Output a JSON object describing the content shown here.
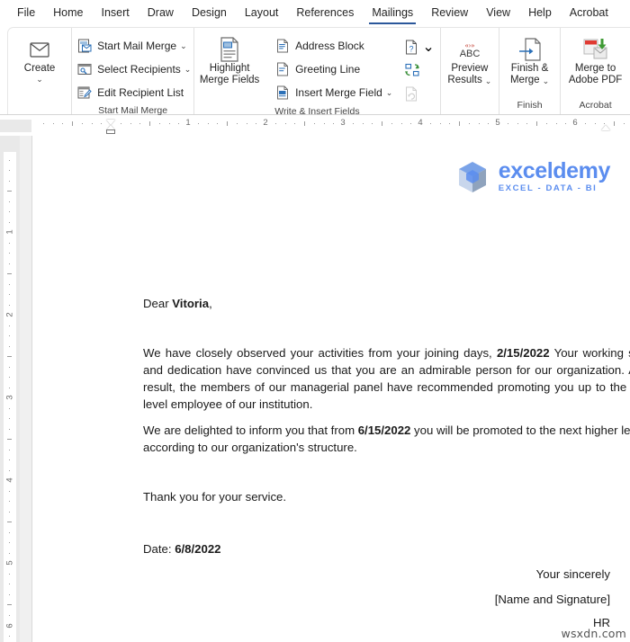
{
  "theme": {
    "accent": "#2b579a",
    "logo_blue": "#5b8def",
    "ribbon_border": "#d4d4d4"
  },
  "tabs": [
    {
      "label": "File",
      "active": false
    },
    {
      "label": "Home",
      "active": false
    },
    {
      "label": "Insert",
      "active": false
    },
    {
      "label": "Draw",
      "active": false
    },
    {
      "label": "Design",
      "active": false
    },
    {
      "label": "Layout",
      "active": false
    },
    {
      "label": "References",
      "active": false
    },
    {
      "label": "Mailings",
      "active": true
    },
    {
      "label": "Review",
      "active": false
    },
    {
      "label": "View",
      "active": false
    },
    {
      "label": "Help",
      "active": false
    },
    {
      "label": "Acrobat",
      "active": false
    }
  ],
  "ribbon": {
    "groups": [
      {
        "name": "create",
        "label": "",
        "big": {
          "label": "Create",
          "icon": "envelope-icon",
          "caret": "⌄"
        }
      },
      {
        "name": "start-mail-merge",
        "label": "Start Mail Merge",
        "items": [
          {
            "label": "Start Mail Merge",
            "icon": "start-mail-merge-icon",
            "caret": "⌄"
          },
          {
            "label": "Select Recipients",
            "icon": "select-recipients-icon",
            "caret": "⌄"
          },
          {
            "label": "Edit Recipient List",
            "icon": "edit-recipient-list-icon",
            "caret": ""
          }
        ]
      },
      {
        "name": "write-insert-fields",
        "label": "Write & Insert Fields",
        "big": {
          "label": "Highlight\nMerge Fields",
          "line1": "Highlight",
          "line2": "Merge Fields",
          "icon": "highlight-merge-fields-icon"
        },
        "items": [
          {
            "label": "Address Block",
            "icon": "address-block-icon",
            "caret": ""
          },
          {
            "label": "Greeting Line",
            "icon": "greeting-line-icon",
            "caret": ""
          },
          {
            "label": "Insert Merge Field",
            "icon": "insert-merge-field-icon",
            "caret": "⌄"
          }
        ],
        "icons": [
          {
            "name": "rules-icon",
            "caret": "⌄",
            "disabled": false
          },
          {
            "name": "match-fields-icon",
            "caret": "",
            "disabled": false
          },
          {
            "name": "update-labels-icon",
            "caret": "",
            "disabled": true
          }
        ]
      },
      {
        "name": "preview-results",
        "label": "",
        "big": {
          "line1": "Preview",
          "line2": "Results",
          "icon": "preview-results-abc-icon",
          "caret": "⌄",
          "abc_top": "«»",
          "abc": "ABC"
        }
      },
      {
        "name": "finish",
        "label": "Finish",
        "big": {
          "line1": "Finish &",
          "line2": "Merge",
          "icon": "finish-merge-icon",
          "caret": "⌄"
        }
      },
      {
        "name": "acrobat",
        "label": "Acrobat",
        "big": {
          "line1": "Merge to",
          "line2": "Adobe PDF",
          "icon": "merge-to-adobe-pdf-icon"
        }
      }
    ]
  },
  "ruler": {
    "horizontal_numbers": [
      "1",
      "2",
      "3",
      "4",
      "5",
      "6"
    ],
    "vertical_numbers": [
      "1",
      "2",
      "3",
      "4",
      "5",
      "6"
    ]
  },
  "document": {
    "logo": {
      "name": "exceldemy",
      "tagline": "EXCEL - DATA - BI",
      "icon": "exceldemy-cube-logo"
    },
    "salutation_prefix": "Dear ",
    "salutation_name": "Vitoria",
    "salutation_suffix": ",",
    "para1_a": "We have closely observed your activities from your joining days, ",
    "para1_date": "2/15/2022",
    "para1_b": " Your working spirit and dedication have convinced us that you are an admirable person for our organization. As a result, the members of our managerial panel have recommended promoting you up to the next level employee of our institution.",
    "para2_a": "We are delighted to inform you that from ",
    "para2_date": "6/15/2022",
    "para2_b": " you will be promoted to the next higher level according to our organization's structure.",
    "thanks": "Thank you for your service.",
    "date_label": "Date: ",
    "date_value": "6/8/2022",
    "closing": "Your sincerely",
    "signature": "[Name and Signature]",
    "role": "HR",
    "watermark": "wsxdn.com"
  }
}
